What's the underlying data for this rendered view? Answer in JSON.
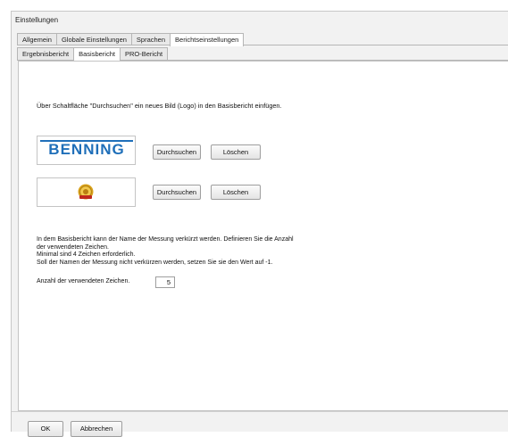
{
  "window": {
    "title": "Einstellungen"
  },
  "tabs": [
    "Allgemein",
    "Globale Einstellungen",
    "Sprachen",
    "Berichtseinstellungen"
  ],
  "subtabs": [
    "Ergebnisbericht",
    "Basisbericht",
    "PRO-Bericht"
  ],
  "content": {
    "intro": "Über Schaltfläche \"Durchsuchen\" ein neues Bild (Logo) in den Basisbericht einfügen.",
    "logo1_text": "BENNING",
    "logo2_icon": "gold-seal-badge-icon",
    "browse_label": "Durchsuchen",
    "delete_label": "Löschen",
    "desc_lines": [
      "In dem Basisbericht kann der Name der Messung verkürzt werden. Definieren Sie die Anzahl",
      "der verwendeten Zeichen.",
      "Minimal sind 4 Zeichen erforderlich.",
      "Soll der Namen der Messung nicht verkürzen werden, setzen Sie sie den Wert auf -1."
    ],
    "count_label": "Anzahl der verwendeten Zeichen.",
    "count_value": "5"
  },
  "footer": {
    "ok_label": "OK",
    "cancel_label": "Abbrechen"
  },
  "colors": {
    "brand": "#1f6fb9",
    "badge_gold": "#d9a21b",
    "badge_red": "#c0281c"
  }
}
